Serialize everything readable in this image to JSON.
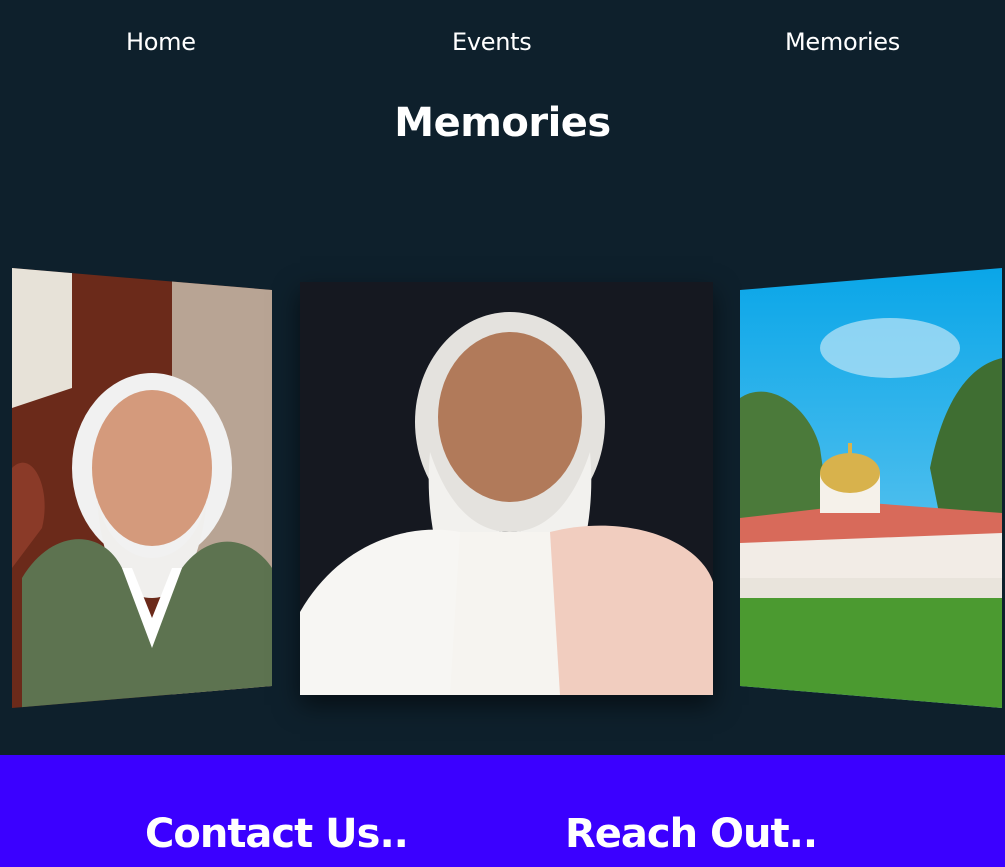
{
  "nav": {
    "items": [
      {
        "label": "Home"
      },
      {
        "label": "Events"
      },
      {
        "label": "Memories"
      }
    ]
  },
  "memories": {
    "title": "Memories",
    "slides": [
      {
        "subject": "elderly man with white hair and beard wearing green sweater vest",
        "position": "left"
      },
      {
        "subject": "elderly man with long white beard in white kurta and peach shawl",
        "position": "center"
      },
      {
        "subject": "white building with golden dome and red roof over green lawn",
        "position": "right"
      }
    ]
  },
  "footer": {
    "contact_heading": "Contact Us..",
    "reach_heading": "Reach Out.."
  },
  "colors": {
    "background": "#0e202c",
    "footer": "#3b00ff",
    "text": "#ffffff"
  }
}
